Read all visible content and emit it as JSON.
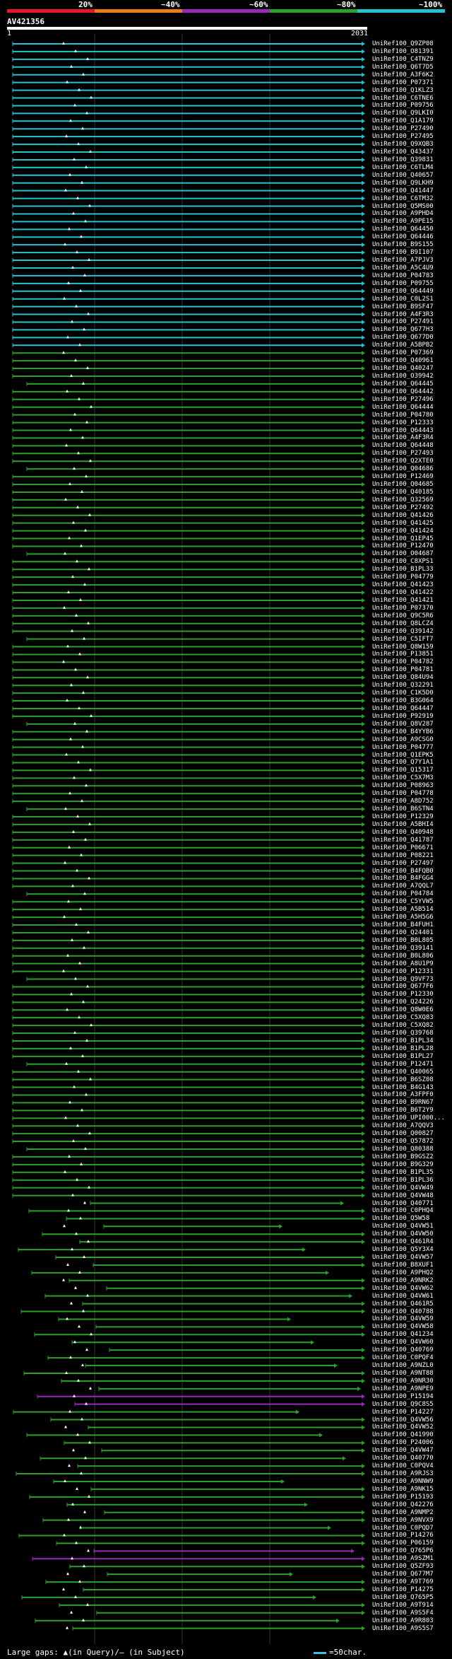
{
  "legend": {
    "labels": [
      "20%",
      "~40%",
      "~60%",
      "~80%",
      "~100%"
    ],
    "colors": [
      "#e8162a",
      "#e87d10",
      "#9a28b8",
      "#2aa12a",
      "#27c2cf"
    ]
  },
  "query": {
    "id": "AV421356",
    "start": "1",
    "end": "2031"
  },
  "footer": {
    "gaps_note": "Large gaps: ▲(in Query)/— (in Subject)",
    "scale_label": "=50char."
  },
  "hits": [
    "UniRef100_Q9ZP08",
    "UniRef100_O81391",
    "UniRef100_C4TNZ9",
    "UniRef100_Q6T7D5",
    "UniRef100_A3F6K2",
    "UniRef100_P07371",
    "UniRef100_Q1KLZ3",
    "UniRef100_C6TNE6",
    "UniRef100_P09756",
    "UniRef100_Q9LKI0",
    "UniRef100_Q1A179",
    "UniRef100_P27490",
    "UniRef100_P27495",
    "UniRef100_Q9XQB3",
    "UniRef100_Q43437",
    "UniRef100_Q39831",
    "UniRef100_C6TLM4",
    "UniRef100_Q40657",
    "UniRef100_Q9LKH9",
    "UniRef100_Q41447",
    "UniRef100_C6TM32",
    "UniRef100_Q5MS00",
    "UniRef100_A9PHD4",
    "UniRef100_A9PE15",
    "UniRef100_Q64450",
    "UniRef100_Q64446",
    "UniRef100_B9S155",
    "UniRef100_B9I107",
    "UniRef100_A7PJV3",
    "UniRef100_A5C4U9",
    "UniRef100_P04783",
    "UniRef100_P09755",
    "UniRef100_Q64449",
    "UniRef100_C0L2S1",
    "UniRef100_B9SF47",
    "UniRef100_A4F3R3",
    "UniRef100_P27491",
    "UniRef100_Q677H3",
    "UniRef100_Q677D0",
    "UniRef100_A5BPB2",
    "UniRef100_P07369",
    "UniRef100_Q40961",
    "UniRef100_Q40247",
    "UniRef100_O39942",
    "UniRef100_Q64445",
    "UniRef100_Q64442",
    "UniRef100_P27496",
    "UniRef100_Q64444",
    "UniRef100_P04780",
    "UniRef100_P12333",
    "UniRef100_Q64443",
    "UniRef100_A4F3R4",
    "UniRef100_Q64448",
    "UniRef100_P27493",
    "UniRef100_Q2XTE0",
    "UniRef100_Q04686",
    "UniRef100_P12469",
    "UniRef100_Q04685",
    "UniRef100_Q40185",
    "UniRef100_Q32569",
    "UniRef100_P27492",
    "UniRef100_Q41426",
    "UniRef100_Q41425",
    "UniRef100_Q41424",
    "UniRef100_Q1EP45",
    "UniRef100_P12470",
    "UniRef100_O04687",
    "UniRef100_C8XPS1",
    "UniRef100_B1PL33",
    "UniRef100_P04779",
    "UniRef100_Q41423",
    "UniRef100_Q41422",
    "UniRef100_Q41421",
    "UniRef100_P07370",
    "UniRef100_Q9C5R6",
    "UniRef100_Q8LCZ4",
    "UniRef100_Q39142",
    "UniRef100_C5IFT7",
    "UniRef100_Q8W159",
    "UniRef100_P13851",
    "UniRef100_P04782",
    "UniRef100_P04781",
    "UniRef100_Q84U94",
    "UniRef100_Q32291",
    "UniRef100_C1K5D0",
    "UniRef100_B3G064",
    "UniRef100_Q64447",
    "UniRef100_P92919",
    "UniRef100_Q8V287",
    "UniRef100_B4YYB6",
    "UniRef100_A9CSG0",
    "UniRef100_P04777",
    "UniRef100_Q1EPK5",
    "UniRef100_Q7Y1A1",
    "UniRef100_Q15317",
    "UniRef100_C5X7M3",
    "UniRef100_P08963",
    "UniRef100_P04778",
    "UniRef100_A8D752",
    "UniRef100_B6STN4",
    "UniRef100_P12329",
    "UniRef100_A5BHI4",
    "UniRef100_Q40948",
    "UniRef100_Q41787",
    "UniRef100_P06671",
    "UniRef100_P08221",
    "UniRef100_P27497",
    "UniRef100_B4FQB0",
    "UniRef100_B4FGG4",
    "UniRef100_A7QQL7",
    "UniRef100_P04784",
    "UniRef100_C5YVW5",
    "UniRef100_A5B514",
    "UniRef100_A5H5G6",
    "UniRef100_B4FUH1",
    "UniRef100_Q24401",
    "UniRef100_B0L805",
    "UniRef100_Q39141",
    "UniRef100_B0L806",
    "UniRef100_A8U1P9",
    "UniRef100_P12331",
    "UniRef100_Q9VF73",
    "UniRef100_Q677F6",
    "UniRef100_P12330",
    "UniRef100_Q24226",
    "UniRef100_Q8W0E6",
    "UniRef100_C5XQ83",
    "UniRef100_C5XQ82",
    "UniRef100_Q39768",
    "UniRef100_B1PL34",
    "UniRef100_B1PL28",
    "UniRef100_B1PL27",
    "UniRef100_P12471",
    "UniRef100_Q40065",
    "UniRef100_B6SZ08",
    "UniRef100_B4G143",
    "UniRef100_A3FPF0",
    "UniRef100_B9RN67",
    "UniRef100_B6T2Y9",
    "UniRef100_UPI000...",
    "UniRef100_A7QQV3",
    "UniRef100_Q00827",
    "UniRef100_Q57872",
    "UniRef100_Q80388",
    "UniRef100_B9GSZ2",
    "UniRef100_B9G329",
    "UniRef100_B1PL35",
    "UniRef100_B1PL36",
    "UniRef100_Q4VW49",
    "UniRef100_Q4VW48",
    "UniRef100_Q40771",
    "UniRef100_C0PHQ4",
    "UniRef100_Q5W58",
    "UniRef100_Q4VW51",
    "UniRef100_Q4VW50",
    "UniRef100_Q461R4",
    "UniRef100_Q5Y3X4",
    "UniRef100_Q4VW57",
    "UniRef100_B8XUF1",
    "UniRef100_A9PHQ2",
    "UniRef100_A9NRK2",
    "UniRef100_Q4VW62",
    "UniRef100_Q4VW61",
    "UniRef100_Q461R5",
    "UniRef100_Q40788",
    "UniRef100_Q4VW59",
    "UniRef100_Q4VW58",
    "UniRef100_Q41234",
    "UniRef100_Q4VW60",
    "UniRef100_Q40769",
    "UniRef100_C0PQF4",
    "UniRef100_A9NZL0",
    "UniRef100_A9NT88",
    "UniRef100_A9NR30",
    "UniRef100_A9NPE9",
    "UniRef100_P15194",
    "UniRef100_Q9C8S5",
    "UniRef100_P14227",
    "UniRef100_Q4VW56",
    "UniRef100_Q4VW52",
    "UniRef100_Q41990",
    "UniRef100_P24006",
    "UniRef100_Q4VW47",
    "UniRef100_Q40770",
    "UniRef100_C0PQV4",
    "UniRef100_A9RJS3",
    "UniRef100_A9NNW9",
    "UniRef100_A9NK15",
    "UniRef100_P15193",
    "UniRef100_Q42276",
    "UniRef100_A9NMP2",
    "UniRef100_A9NVX9",
    "UniRef100_C0PQD7",
    "UniRef100_P14276",
    "UniRef100_P06159",
    "UniRef100_Q765P6",
    "UniRef100_A9SZM1",
    "UniRef100_Q5ZF93",
    "UniRef100_Q677M7",
    "UniRef100_A9T769",
    "UniRef100_P14275",
    "UniRef100_Q765P5",
    "UniRef100_A9T914",
    "UniRef100_A9S5F4",
    "UniRef100_A9R803",
    "UniRef100_A9S5S7"
  ]
}
